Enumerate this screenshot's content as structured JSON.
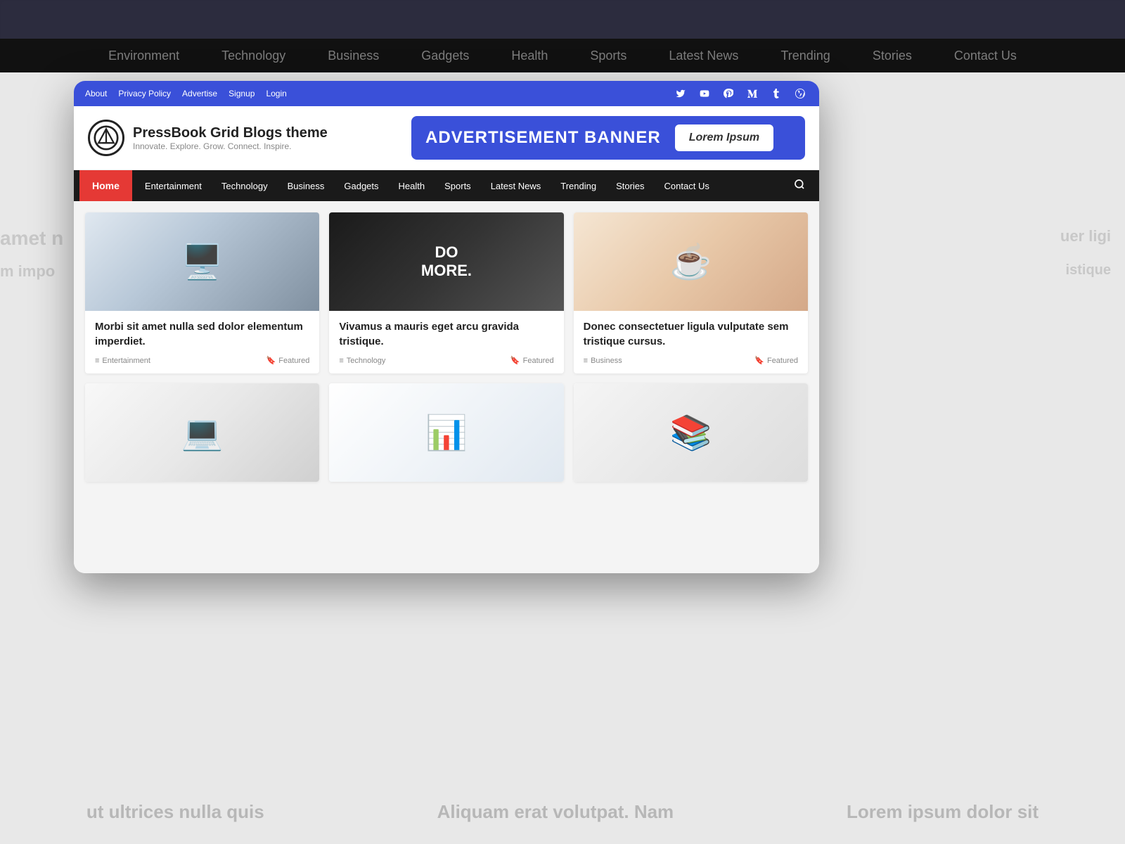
{
  "background": {
    "top_nav_items": [
      "Environment",
      "Technology",
      "Business",
      "Gadgets",
      "Health",
      "Sports",
      "Latest News",
      "Trending",
      "Stories",
      "Contact Us"
    ],
    "bottom_texts": [
      "ut ultrices nulla quis",
      "Aliquam erat volutpat. Nam",
      "Lorem ipsum dolor sit"
    ]
  },
  "utility_bar": {
    "links": [
      "About",
      "Privacy Policy",
      "Advertise",
      "Signup",
      "Login"
    ],
    "social_icons": [
      "twitter",
      "youtube",
      "pinterest",
      "medium",
      "tumblr",
      "wordpress"
    ]
  },
  "header": {
    "logo_symbol": "⚡",
    "site_title": "PressBook Grid Blogs theme",
    "site_tagline": "Innovate. Explore. Grow. Connect. Inspire.",
    "ad_text": "ADVERTISEMENT BANNER",
    "ad_button": "Lorem Ipsum"
  },
  "nav": {
    "home": "Home",
    "items": [
      "Entertainment",
      "Technology",
      "Business",
      "Gadgets",
      "Health",
      "Sports",
      "Latest News",
      "Trending",
      "Stories",
      "Contact Us"
    ]
  },
  "cards": [
    {
      "image_type": "desk1",
      "title": "Morbi sit amet nulla sed dolor elementum imperdiet.",
      "category": "Entertainment",
      "tag": "Featured"
    },
    {
      "image_type": "desk2",
      "image_text": "DO\nMORE.",
      "title": "Vivamus a mauris eget arcu gravida tristique.",
      "category": "Technology",
      "tag": "Featured"
    },
    {
      "image_type": "coffee",
      "title": "Donec consectetuer ligula vulputate sem tristique cursus.",
      "category": "Business",
      "tag": "Featured"
    },
    {
      "image_type": "workspace",
      "title": "",
      "category": "",
      "tag": ""
    },
    {
      "image_type": "monitor",
      "title": "",
      "category": "",
      "tag": ""
    },
    {
      "image_type": "books",
      "title": "",
      "category": "",
      "tag": ""
    }
  ]
}
